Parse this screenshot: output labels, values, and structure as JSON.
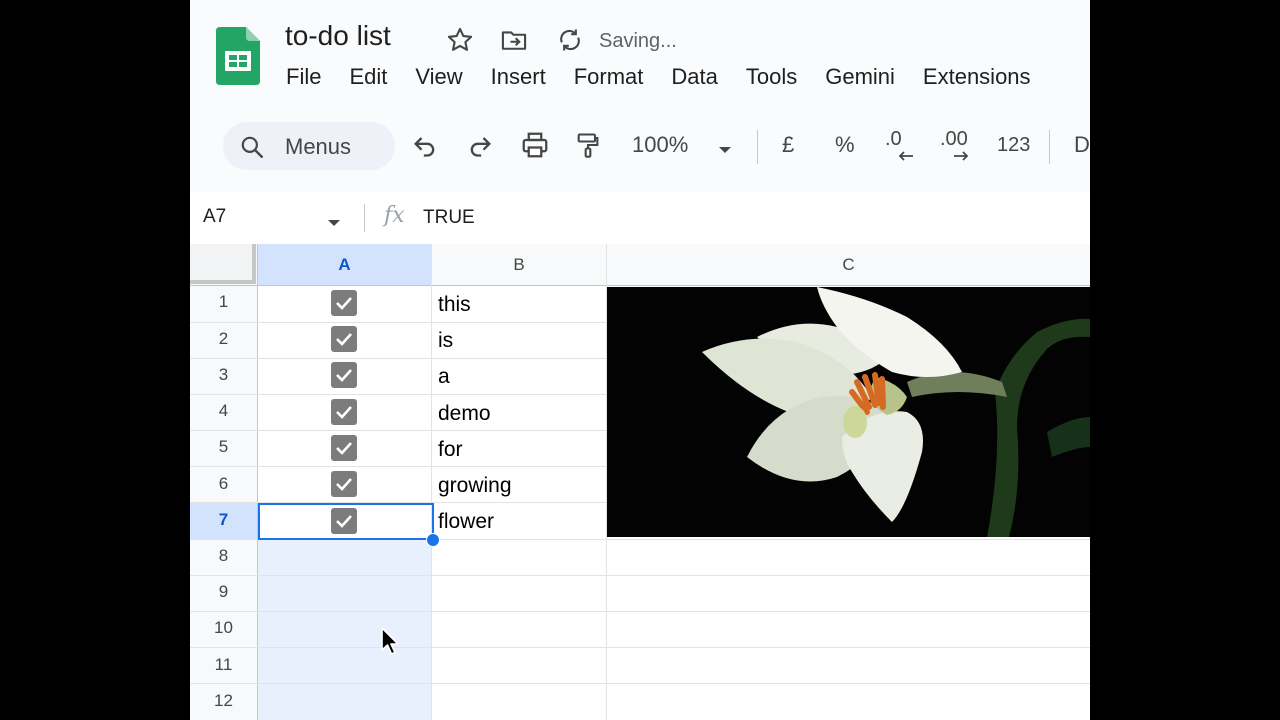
{
  "app": {
    "doc_title": "to-do list",
    "status": "Saving...",
    "menus": [
      "File",
      "Edit",
      "View",
      "Insert",
      "Format",
      "Data",
      "Tools",
      "Gemini",
      "Extensions"
    ]
  },
  "toolbar": {
    "search_label": "Menus",
    "zoom": "100%",
    "currency": "£",
    "percent": "%",
    "decrease_decimal": ".0",
    "increase_decimal": ".00",
    "number_format": "123",
    "font_partial": "D"
  },
  "formula_bar": {
    "name_box": "A7",
    "fx": "fx",
    "value": "TRUE"
  },
  "grid": {
    "columns": [
      "A",
      "B",
      "C"
    ],
    "rows": [
      "1",
      "2",
      "3",
      "4",
      "5",
      "6",
      "7",
      "8",
      "9",
      "10",
      "11",
      "12"
    ],
    "selected_cell": "A7",
    "tasks": [
      {
        "checked": true,
        "text": "this"
      },
      {
        "checked": true,
        "text": "is"
      },
      {
        "checked": true,
        "text": "a"
      },
      {
        "checked": true,
        "text": "demo"
      },
      {
        "checked": true,
        "text": "for"
      },
      {
        "checked": true,
        "text": "growing"
      },
      {
        "checked": true,
        "text": "flower"
      }
    ]
  },
  "colors": {
    "selection": "#1a73e8",
    "selected_header": "#d3e3fd",
    "selected_column_tint": "#e8f0fe",
    "sheets_green": "#0f9d58"
  }
}
